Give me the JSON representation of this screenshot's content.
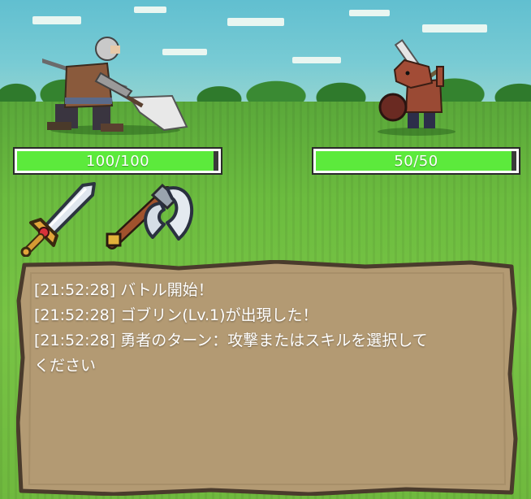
{
  "hero": {
    "name_icon": "hero-warrior-sprite",
    "hp_current": 100,
    "hp_max": 100,
    "hp_text": "100/100"
  },
  "enemy": {
    "name_icon": "goblin-sprite",
    "hp_current": 50,
    "hp_max": 50,
    "hp_text": "50/50"
  },
  "skills": [
    {
      "icon": "sword-icon"
    },
    {
      "icon": "axe-icon"
    }
  ],
  "log": [
    "[21:52:28] バトル開始！",
    "[21:52:28] ゴブリン(Lv.1)が出現した！",
    "[21:52:28] 勇者のターン：攻撃またはスキルを選択して",
    "ください"
  ],
  "colors": {
    "hp_fill": "#5cea3c",
    "panel": "#b39a73",
    "panel_border": "#4a3b2c"
  }
}
